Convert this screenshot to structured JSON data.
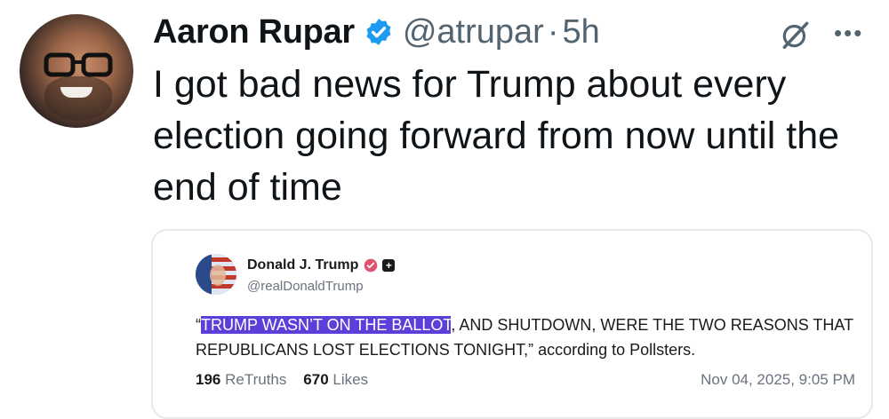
{
  "author": {
    "name": "Aaron Rupar",
    "handle": "@atrupar",
    "separator": "·",
    "time": "5h",
    "verified_color": "#1d9bf0"
  },
  "icons": {
    "verified": "verified-badge-icon",
    "grok": "grok-icon",
    "more": "more-icon"
  },
  "more_glyph": "•••",
  "tweet": {
    "text": "I got bad news for Trump about every election going forward from now until the end of time"
  },
  "quoted": {
    "name": "Donald J. Trump",
    "handle": "@realDonaldTrump",
    "open_quote": "“",
    "highlighted": "TRUMP WASN’T ON THE BALLOT",
    "rest": ", AND SHUTDOWN, WERE THE TWO REASONS THAT REPUBLICANS LOST ELECTIONS TONIGHT,” according to Pollsters.",
    "retruths_count": "196",
    "retruths_label": "ReTruths",
    "likes_count": "670",
    "likes_label": "Likes",
    "date": "Nov 04, 2025, 9:05 PM",
    "highlight_color": "#5b3fd8",
    "plus_glyph": "+"
  }
}
